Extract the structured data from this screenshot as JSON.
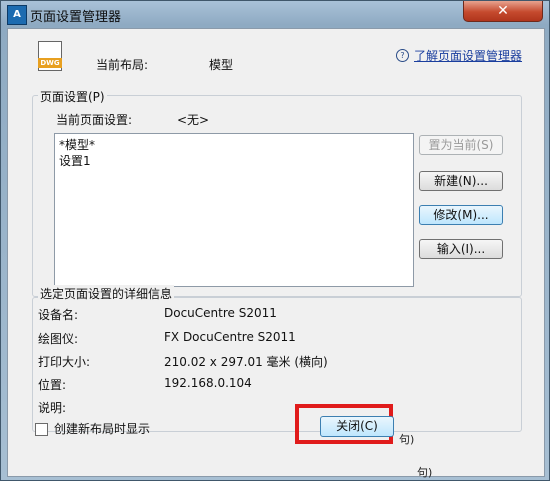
{
  "window": {
    "title": "页面设置管理器",
    "close_glyph": "✕",
    "app_icon_text": "A"
  },
  "header": {
    "file_icon_text": "DWG",
    "current_layout_label": "当前布局:",
    "current_layout_value": "模型",
    "help_icon_glyph": "?",
    "help_link": "了解页面设置管理器"
  },
  "page_setups": {
    "group_title": "页面设置(P)",
    "current_label": "当前页面设置:",
    "current_value": "<无>",
    "items": [
      "*模型*",
      "设置1"
    ],
    "buttons": {
      "set_current": "置为当前(S)",
      "new": "新建(N)...",
      "modify": "修改(M)...",
      "import": "输入(I)..."
    }
  },
  "details": {
    "group_title": "选定页面设置的详细信息",
    "rows": [
      {
        "key": "设备名:",
        "value": "DocuCentre S2011"
      },
      {
        "key": "绘图仪:",
        "value": "FX DocuCentre S2011"
      },
      {
        "key": "打印大小:",
        "value": "210.02 x 297.01 毫米 (横向)"
      },
      {
        "key": "位置:",
        "value": "192.168.0.104"
      },
      {
        "key": "说明:",
        "value": ""
      }
    ]
  },
  "footer": {
    "checkbox_label": "创建新布局时显示",
    "close_button": "关闭(C)",
    "fragment_top": "句)",
    "fragment_bottom": "句)"
  },
  "colors": {
    "highlight": "#e01b1b",
    "link": "#1a3e9e"
  }
}
